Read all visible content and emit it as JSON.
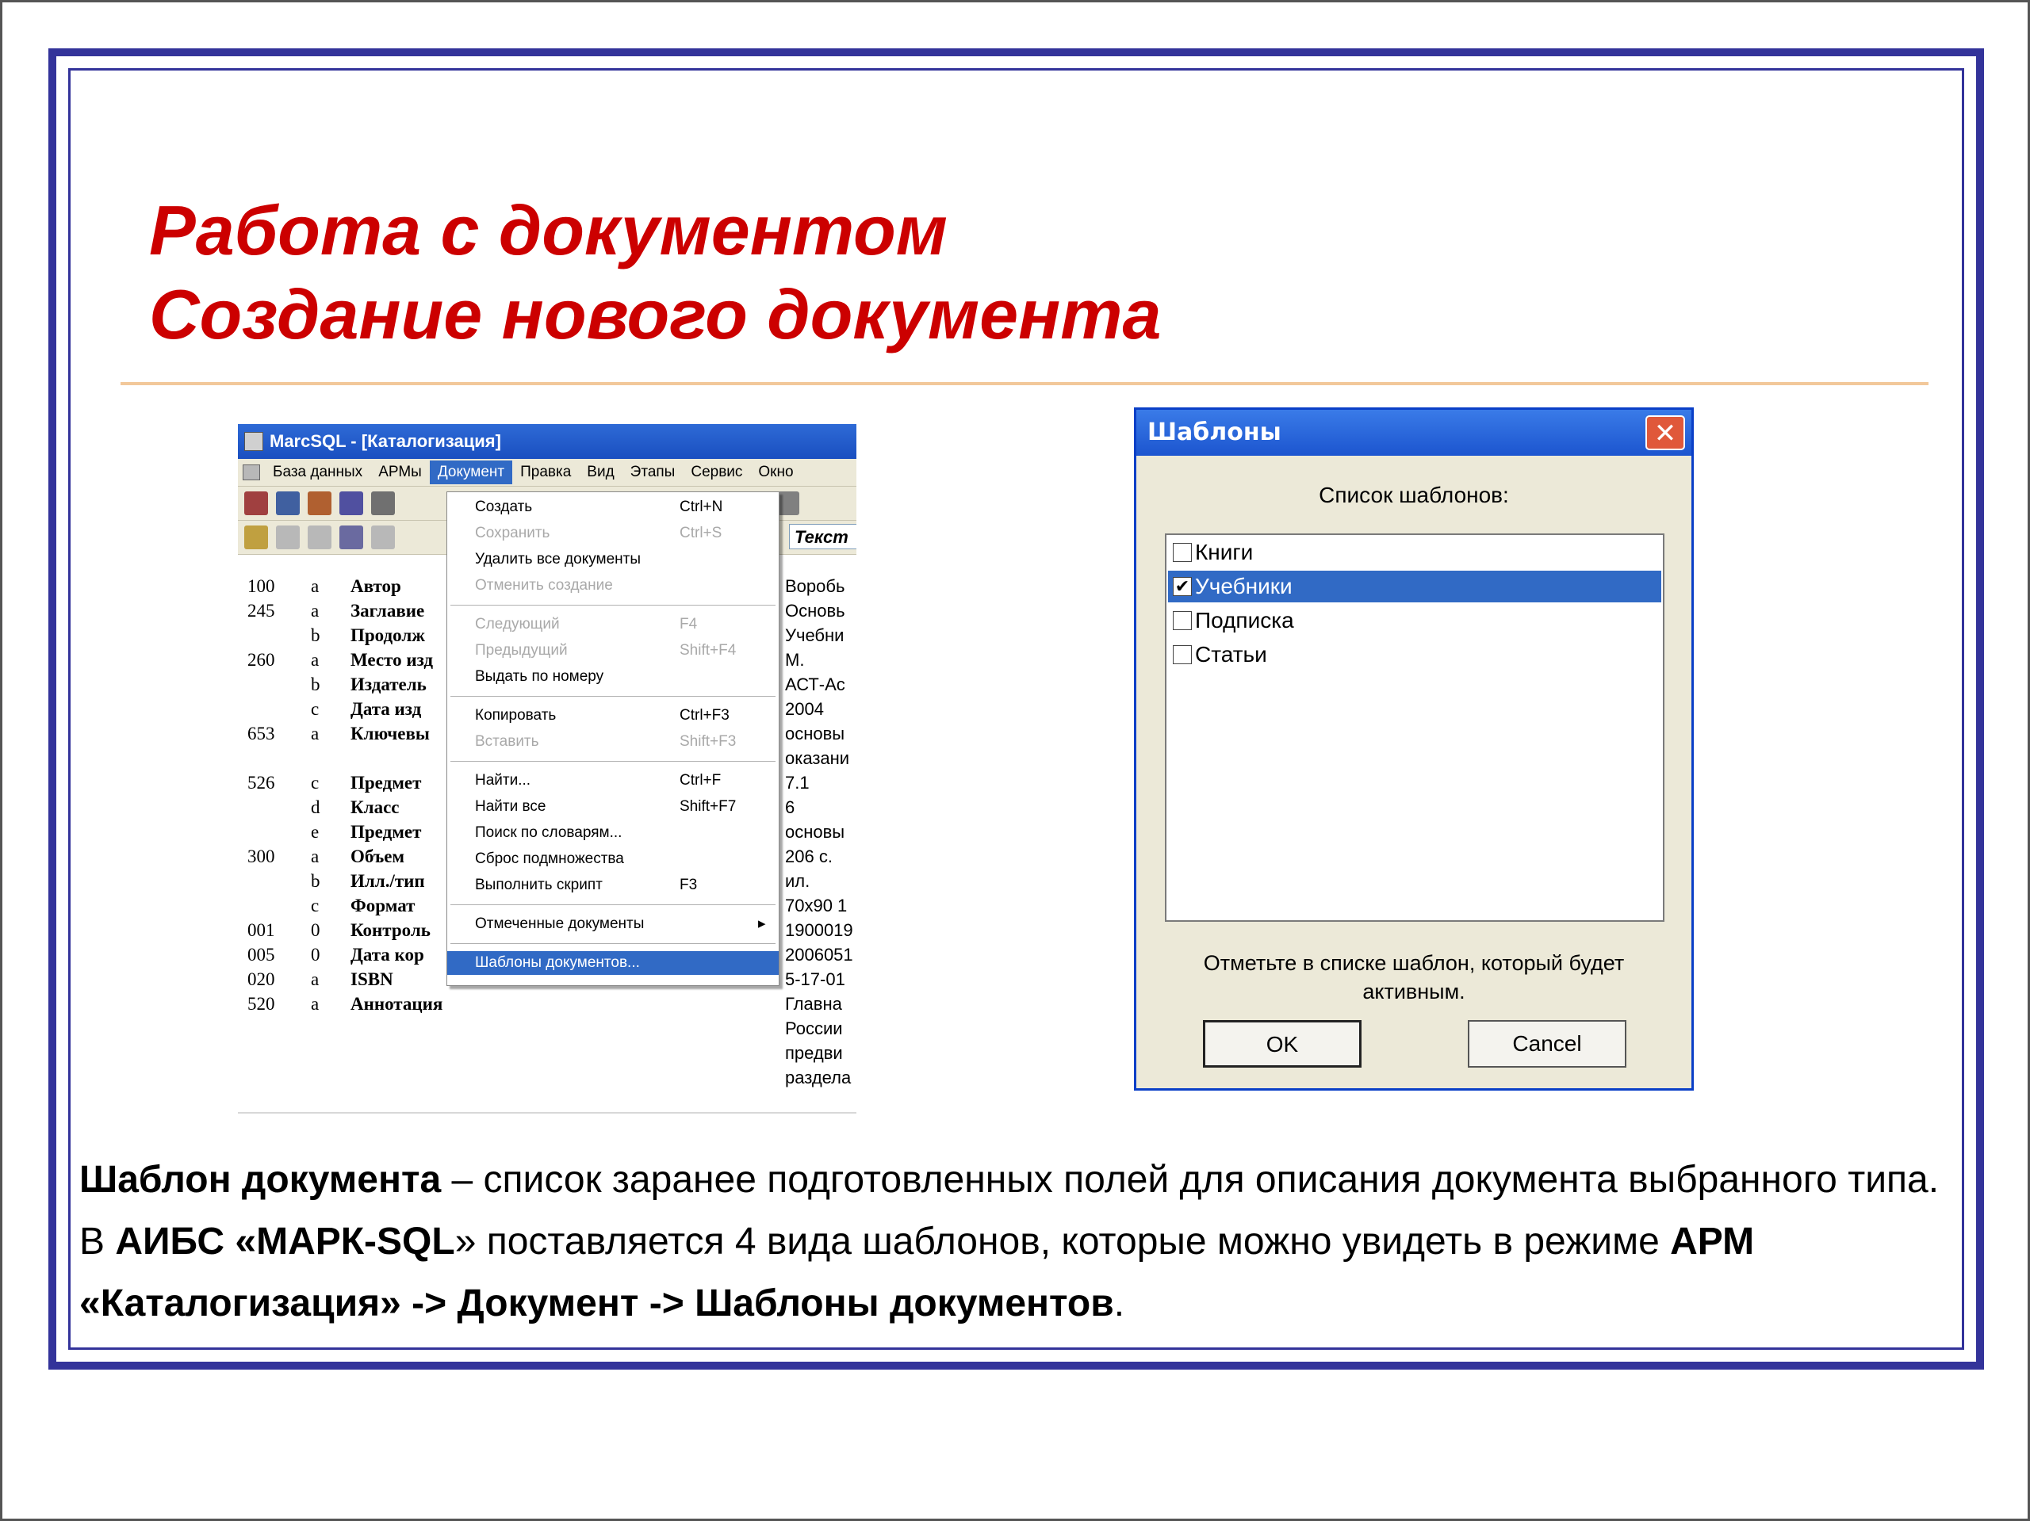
{
  "slide": {
    "title_line1": "Работа с документом",
    "title_line2": "Создание нового документа"
  },
  "marc_window": {
    "title": "MarcSQL - [Каталогизация]",
    "menu": [
      "База данных",
      "АРМы",
      "Документ",
      "Правка",
      "Вид",
      "Этапы",
      "Сервис",
      "Окно"
    ],
    "active_menu": "Документ",
    "text_box": "Текст",
    "rows": [
      {
        "tag": "100",
        "sub": "a",
        "name": "Автор",
        "val": "Воробь"
      },
      {
        "tag": "245",
        "sub": "a",
        "name": "Заглавие",
        "val": "Основь"
      },
      {
        "tag": "",
        "sub": "b",
        "name": "Продолж",
        "val": "Учебни"
      },
      {
        "tag": "260",
        "sub": "a",
        "name": "Место изд",
        "val": "М."
      },
      {
        "tag": "",
        "sub": "b",
        "name": "Издатель",
        "val": "АСТ-Ас"
      },
      {
        "tag": "",
        "sub": "c",
        "name": "Дата изд",
        "val": "2004"
      },
      {
        "tag": "653",
        "sub": "a",
        "name": "Ключевы",
        "val": "основы"
      },
      {
        "tag": "",
        "sub": "",
        "name": "",
        "val": "оказани"
      },
      {
        "tag": "526",
        "sub": "c",
        "name": "Предмет",
        "val": "7.1"
      },
      {
        "tag": "",
        "sub": "d",
        "name": "Класс",
        "val": "6"
      },
      {
        "tag": "",
        "sub": "e",
        "name": "Предмет",
        "val": "основы"
      },
      {
        "tag": "300",
        "sub": "a",
        "name": "Объем",
        "val": "206 с."
      },
      {
        "tag": "",
        "sub": "b",
        "name": "Илл./тип",
        "val": "ил."
      },
      {
        "tag": "",
        "sub": "c",
        "name": "Формат",
        "val": "70х90 1"
      },
      {
        "tag": "001",
        "sub": "0",
        "name": "Контроль",
        "val": "1900019"
      },
      {
        "tag": "005",
        "sub": "0",
        "name": "Дата кор",
        "val": "2006051"
      },
      {
        "tag": "020",
        "sub": "a",
        "name": "ISBN",
        "val": "5-17-01"
      },
      {
        "tag": "520",
        "sub": "a",
        "name": "Аннотация",
        "val": "Главна"
      },
      {
        "tag": "",
        "sub": "",
        "name": "",
        "val": "России"
      },
      {
        "tag": "",
        "sub": "",
        "name": "",
        "val": "предви"
      },
      {
        "tag": "",
        "sub": "",
        "name": "",
        "val": "раздела"
      }
    ]
  },
  "doc_menu": {
    "items": [
      {
        "label": "Создать",
        "shortcut": "Ctrl+N",
        "disabled": false
      },
      {
        "label": "Сохранить",
        "shortcut": "Ctrl+S",
        "disabled": true
      },
      {
        "label": "Удалить все документы",
        "shortcut": "",
        "disabled": false
      },
      {
        "label": "Отменить создание",
        "shortcut": "",
        "disabled": true
      },
      {
        "label": "Следующий",
        "shortcut": "F4",
        "disabled": true
      },
      {
        "label": "Предыдущий",
        "shortcut": "Shift+F4",
        "disabled": true
      },
      {
        "label": "Выдать по номеру",
        "shortcut": "",
        "disabled": false
      },
      {
        "label": "Копировать",
        "shortcut": "Ctrl+F3",
        "disabled": false
      },
      {
        "label": "Вставить",
        "shortcut": "Shift+F3",
        "disabled": true
      },
      {
        "label": "Найти...",
        "shortcut": "Ctrl+F",
        "disabled": false
      },
      {
        "label": "Найти все",
        "shortcut": "Shift+F7",
        "disabled": false
      },
      {
        "label": "Поиск по словарям...",
        "shortcut": "",
        "disabled": false
      },
      {
        "label": "Сброс подмножества",
        "shortcut": "",
        "disabled": false
      },
      {
        "label": "Выполнить скрипт",
        "shortcut": "F3",
        "disabled": false
      },
      {
        "label": "Отмеченные документы",
        "shortcut": "",
        "disabled": false,
        "submenu": true
      },
      {
        "label": "Шаблоны документов...",
        "shortcut": "",
        "disabled": false,
        "highlight": true
      }
    ]
  },
  "templates_dialog": {
    "title": "Шаблоны",
    "close_glyph": "✕",
    "list_label": "Список шаблонов:",
    "items": [
      {
        "label": "Книги",
        "checked": false,
        "selected": false
      },
      {
        "label": "Учебники",
        "checked": true,
        "selected": true
      },
      {
        "label": "Подписка",
        "checked": false,
        "selected": false
      },
      {
        "label": "Статьи",
        "checked": false,
        "selected": false
      }
    ],
    "note_line1": "Отметьте в списке шаблон, который будет",
    "note_line2": "активным.",
    "ok_label": "OK",
    "cancel_label": "Cancel"
  },
  "body": {
    "p1_bold": "Шаблон документа",
    "p1_rest": " – список заранее подготовленных полей для описания документа выбранного типа.",
    "p2_pre": "В ",
    "p2_bold1": "АИБС «МАРК-SQL",
    "p2_mid": "» поставляется 4 вида шаблонов, которые можно увидеть в режиме ",
    "p2_bold2": "АРМ «Каталогизация» -> Документ -> Шаблоны документов",
    "p2_end": "."
  },
  "colors": {
    "title": "#cc0000",
    "frame": "#33339a",
    "selection": "#316ac5"
  }
}
